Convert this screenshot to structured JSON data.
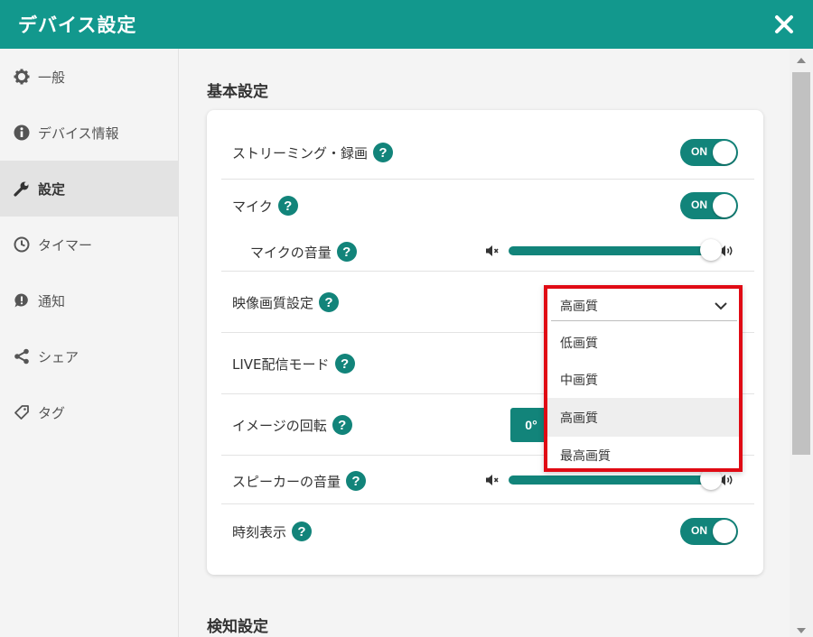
{
  "header": {
    "title": "デバイス設定"
  },
  "sidebar": {
    "items": [
      {
        "label": "一般",
        "icon": "gear-icon"
      },
      {
        "label": "デバイス情報",
        "icon": "info-icon"
      },
      {
        "label": "設定",
        "icon": "wrench-icon",
        "active": true
      },
      {
        "label": "タイマー",
        "icon": "clock-icon"
      },
      {
        "label": "通知",
        "icon": "notification-icon"
      },
      {
        "label": "シェア",
        "icon": "share-icon"
      },
      {
        "label": "タグ",
        "icon": "tag-icon"
      }
    ]
  },
  "main": {
    "basic_section_title": "基本設定",
    "detect_section_title": "検知設定",
    "rows": {
      "streaming": {
        "label": "ストリーミング・録画",
        "toggle": "ON"
      },
      "mic": {
        "label": "マイク",
        "toggle": "ON"
      },
      "mic_volume": {
        "label": "マイクの音量",
        "level": 1.0
      },
      "video_quality": {
        "label": "映像画質設定"
      },
      "live_mode": {
        "label": "LIVE配信モード"
      },
      "rotation": {
        "label": "イメージの回転",
        "button": "0°"
      },
      "speaker_volume": {
        "label": "スピーカーの音量",
        "level": 1.0
      },
      "time_display": {
        "label": "時刻表示",
        "toggle": "ON"
      }
    },
    "help_glyph": "?"
  },
  "dropdown": {
    "selected": "高画質",
    "options": [
      "低画質",
      "中画質",
      "高画質",
      "最高画質"
    ],
    "highlighted_index": 2
  },
  "colors": {
    "header": "#12988d",
    "accent": "#12847a",
    "highlight_border": "#e00a14"
  }
}
